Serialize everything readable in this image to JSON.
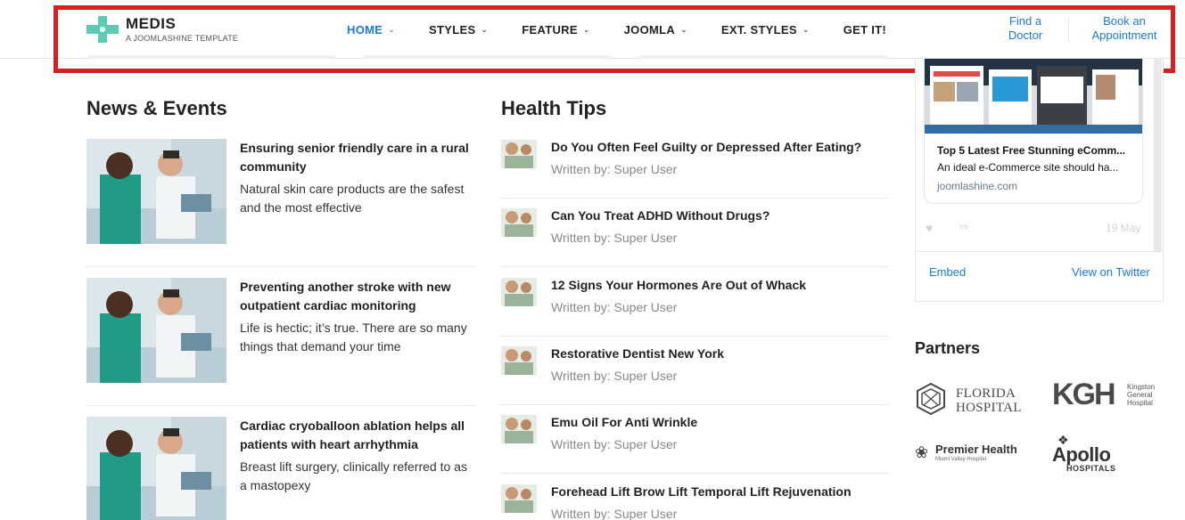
{
  "brand": {
    "name": "MEDIS",
    "tagline": "A JOOMLASHINE TEMPLATE",
    "accent_color": "#5ccab4"
  },
  "nav": {
    "items": [
      {
        "label": "HOME",
        "has_dropdown": true,
        "active": true
      },
      {
        "label": "STYLES",
        "has_dropdown": true
      },
      {
        "label": "FEATURE",
        "has_dropdown": true
      },
      {
        "label": "JOOMLA",
        "has_dropdown": true
      },
      {
        "label": "EXT. STYLES",
        "has_dropdown": true
      },
      {
        "label": "GET IT!",
        "has_dropdown": false
      }
    ],
    "active_color": "#1a7bd0",
    "dropdown_icon": "chevron-down-icon"
  },
  "header_links": {
    "find_doctor_line1": "Find a",
    "find_doctor_line2": "Doctor",
    "book_line1": "Book an",
    "book_line2": "Appointment"
  },
  "highlight_color": "#d81e1e",
  "news": {
    "title": "News & Events",
    "items": [
      {
        "title": "Ensuring senior friendly care in a rural community",
        "description": "Natural skin care products are the safest and the most effective"
      },
      {
        "title": "Preventing another stroke with new outpatient cardiac monitoring",
        "description": "Life is hectic; it’s true. There are so many things that demand your time"
      },
      {
        "title": "Cardiac cryoballoon ablation helps all patients with heart arrhythmia",
        "description": "Breast lift surgery, clinically referred to as a mastopexy"
      }
    ]
  },
  "tips": {
    "title": "Health Tips",
    "items": [
      {
        "title": "Do You Often Feel Guilty or Depressed After Eating?",
        "author": "Written by: Super User"
      },
      {
        "title": "Can You Treat ADHD Without Drugs?",
        "author": "Written by: Super User"
      },
      {
        "title": "12 Signs Your Hormones Are Out of Whack",
        "author": "Written by: Super User"
      },
      {
        "title": "Restorative Dentist New York",
        "author": "Written by: Super User"
      },
      {
        "title": "Emu Oil For Anti Wrinkle",
        "author": "Written by: Super User"
      },
      {
        "title": "Forehead Lift Brow Lift Temporal Lift Rejuvenation",
        "author": "Written by: Super User"
      }
    ]
  },
  "twitter": {
    "card_title": "Top 5 Latest Free Stunning eComm...",
    "card_description": "An ideal e-Commerce site should ha...",
    "card_domain": "joomlashine.com",
    "date": "19 May",
    "embed_label": "Embed",
    "view_label": "View on Twitter",
    "like_icon": "heart-icon",
    "share_icon": "share-icon"
  },
  "partners": {
    "title": "Partners",
    "florida_line1": "FLORIDA",
    "florida_line2": "HOSPITAL",
    "kgh_mark": "KGH",
    "kgh_sub1": "Kingston",
    "kgh_sub2": "General",
    "kgh_sub3": "Hospital",
    "premier_name": "Premier Health",
    "premier_sub": "Miami Valley Hospital",
    "apollo_name": "Apollo",
    "apollo_sub": "HOSPITALS"
  }
}
